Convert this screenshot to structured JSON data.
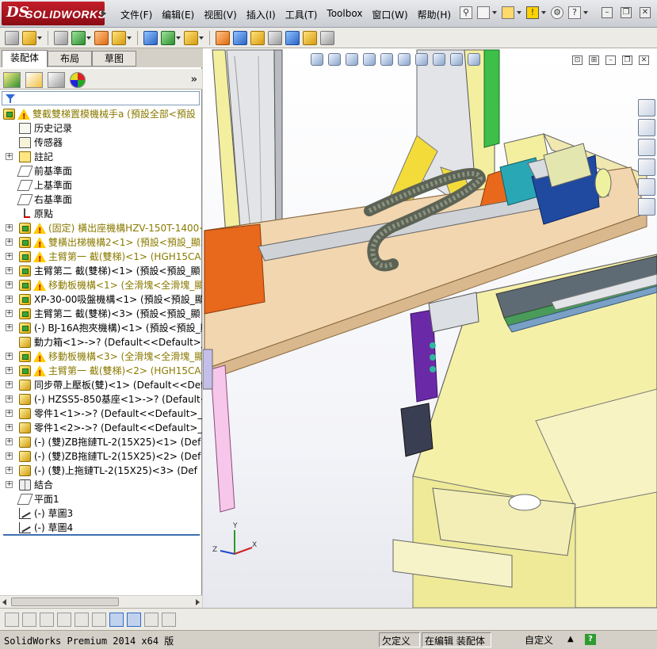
{
  "app": {
    "logo_ds": "DS",
    "logo_name": "SOLIDWORKS"
  },
  "menu": [
    "文件(F)",
    "编辑(E)",
    "视图(V)",
    "插入(I)",
    "工具(T)",
    "Toolbox",
    "窗口(W)",
    "帮助(H)"
  ],
  "top_icons": [
    "pin-icon",
    "new-document-icon",
    "open-icon",
    "warning-icon",
    "gear-icon",
    "help-icon"
  ],
  "window_controls": [
    "minimize",
    "restore",
    "close"
  ],
  "toolbar_icons": [
    "insert-component-icon",
    "mate-icon",
    "linear-pattern-icon",
    "smart-fasteners-icon",
    "move-component-icon",
    "show-hidden-icon",
    "assembly-features-icon",
    "reference-geometry-icon",
    "new-motion-study-icon",
    "bill-of-materials-icon",
    "exploded-view-icon",
    "explode-line-sketch-icon",
    "interference-detection-icon",
    "clearance-verification-icon",
    "hole-alignment-icon",
    "measure-icon"
  ],
  "panel_tabs": [
    "装配体",
    "布局",
    "草图"
  ],
  "panel_tab_active": 0,
  "tree": [
    {
      "label": "雙截雙梯置模機械手a  (預設全部<預設",
      "icon": "assembly",
      "warn": true,
      "expand": "-",
      "indent": 0
    },
    {
      "label": "历史记录",
      "icon": "history",
      "warn": false,
      "expand": "",
      "indent": 1
    },
    {
      "label": "传感器",
      "icon": "sensor",
      "warn": false,
      "expand": "",
      "indent": 1
    },
    {
      "label": "註記",
      "icon": "note",
      "warn": false,
      "expand": "+",
      "indent": 1
    },
    {
      "label": "前基準面",
      "icon": "plane",
      "warn": false,
      "expand": "",
      "indent": 1
    },
    {
      "label": "上基準面",
      "icon": "plane",
      "warn": false,
      "expand": "",
      "indent": 1
    },
    {
      "label": "右基準面",
      "icon": "plane",
      "warn": false,
      "expand": "",
      "indent": 1
    },
    {
      "label": "原點",
      "icon": "origin",
      "warn": false,
      "expand": "",
      "indent": 1
    },
    {
      "label": "(固定) 橫出座機構HZV-150T-1400<1",
      "icon": "assembly",
      "warn": true,
      "expand": "+",
      "indent": 1
    },
    {
      "label": "雙橫出梯機構2<1> (預設<預設_顯示",
      "icon": "assembly",
      "warn": true,
      "expand": "+",
      "indent": 1
    },
    {
      "label": "主臂第一 截(雙梯)<1> (HGH15CA<",
      "icon": "assembly",
      "warn": true,
      "expand": "+",
      "indent": 1
    },
    {
      "label": "主臂第二 截(雙梯)<1> (預設<預設_顯",
      "icon": "assembly",
      "warn": false,
      "expand": "+",
      "indent": 1
    },
    {
      "label": "移動板機構<1> (全滑塊<全滑塊_顯示",
      "icon": "assembly",
      "warn": true,
      "expand": "+",
      "indent": 1
    },
    {
      "label": "XP-30-00吸盤機構<1> (預設<預設_顯示",
      "icon": "assembly",
      "warn": false,
      "expand": "+",
      "indent": 1
    },
    {
      "label": "主臂第二 截(雙梯)<3> (預設<預設_顯",
      "icon": "assembly",
      "warn": false,
      "expand": "+",
      "indent": 1
    },
    {
      "label": "(-) BJ-16A抱夾機構)<1> (預設<預設_顯",
      "icon": "assembly",
      "warn": false,
      "expand": "+",
      "indent": 1
    },
    {
      "label": "動力箱<1>->? (Default<<Default>_外观",
      "icon": "part",
      "warn": false,
      "expand": "",
      "indent": 1
    },
    {
      "label": "移動板機構<3> (全滑塊<全滑塊_顯示",
      "icon": "assembly",
      "warn": true,
      "expand": "+",
      "indent": 1
    },
    {
      "label": "主臂第一 截(雙梯)<2> (HGH15CA<",
      "icon": "assembly",
      "warn": true,
      "expand": "+",
      "indent": 1
    },
    {
      "label": "同步帶上壓板(雙)<1> (Default<<Def",
      "icon": "part",
      "warn": false,
      "expand": "+",
      "indent": 1
    },
    {
      "label": "(-) HZSS5-850基座<1>->? (Default<<D",
      "icon": "part",
      "warn": false,
      "expand": "+",
      "indent": 1
    },
    {
      "label": "零件1<1>->? (Default<<Default>_外观",
      "icon": "part",
      "warn": false,
      "expand": "+",
      "indent": 1
    },
    {
      "label": "零件1<2>->? (Default<<Default>_外观",
      "icon": "part",
      "warn": false,
      "expand": "+",
      "indent": 1
    },
    {
      "label": "(-) (雙)ZB拖鏈TL-2(15X25)<1> (Def",
      "icon": "part",
      "warn": false,
      "expand": "+",
      "indent": 1
    },
    {
      "label": "(-) (雙)ZB拖鏈TL-2(15X25)<2> (Def",
      "icon": "part",
      "warn": false,
      "expand": "+",
      "indent": 1
    },
    {
      "label": "(-) (雙)上拖鏈TL-2(15X25)<3> (Def",
      "icon": "part",
      "warn": false,
      "expand": "+",
      "indent": 1
    },
    {
      "label": "結合",
      "icon": "mate",
      "warn": false,
      "expand": "+",
      "indent": 1
    },
    {
      "label": "平面1",
      "icon": "plane",
      "warn": false,
      "expand": "",
      "indent": 1
    },
    {
      "label": "(-) 草圖3",
      "icon": "sketch",
      "warn": false,
      "expand": "",
      "indent": 1
    },
    {
      "label": "(-) 草圖4",
      "icon": "sketch",
      "warn": false,
      "expand": "",
      "indent": 1
    }
  ],
  "triad": {
    "x": "X",
    "y": "Y",
    "z": "Z"
  },
  "status": {
    "app": "SolidWorks Premium 2014 x64 版",
    "constraint": "欠定义",
    "mode": "在编辑 装配体",
    "units": "自定义",
    "up": "▲",
    "help": "?"
  },
  "colors": {
    "frame": "#f5f0a8",
    "beam": "#f3d9b4",
    "orange": "#e8681c",
    "chain": "#6a6e62",
    "cyan": "#2aa7b5",
    "blue": "#1f4aa0",
    "purple": "#6a2aa8",
    "pink": "#f6c7ea"
  }
}
